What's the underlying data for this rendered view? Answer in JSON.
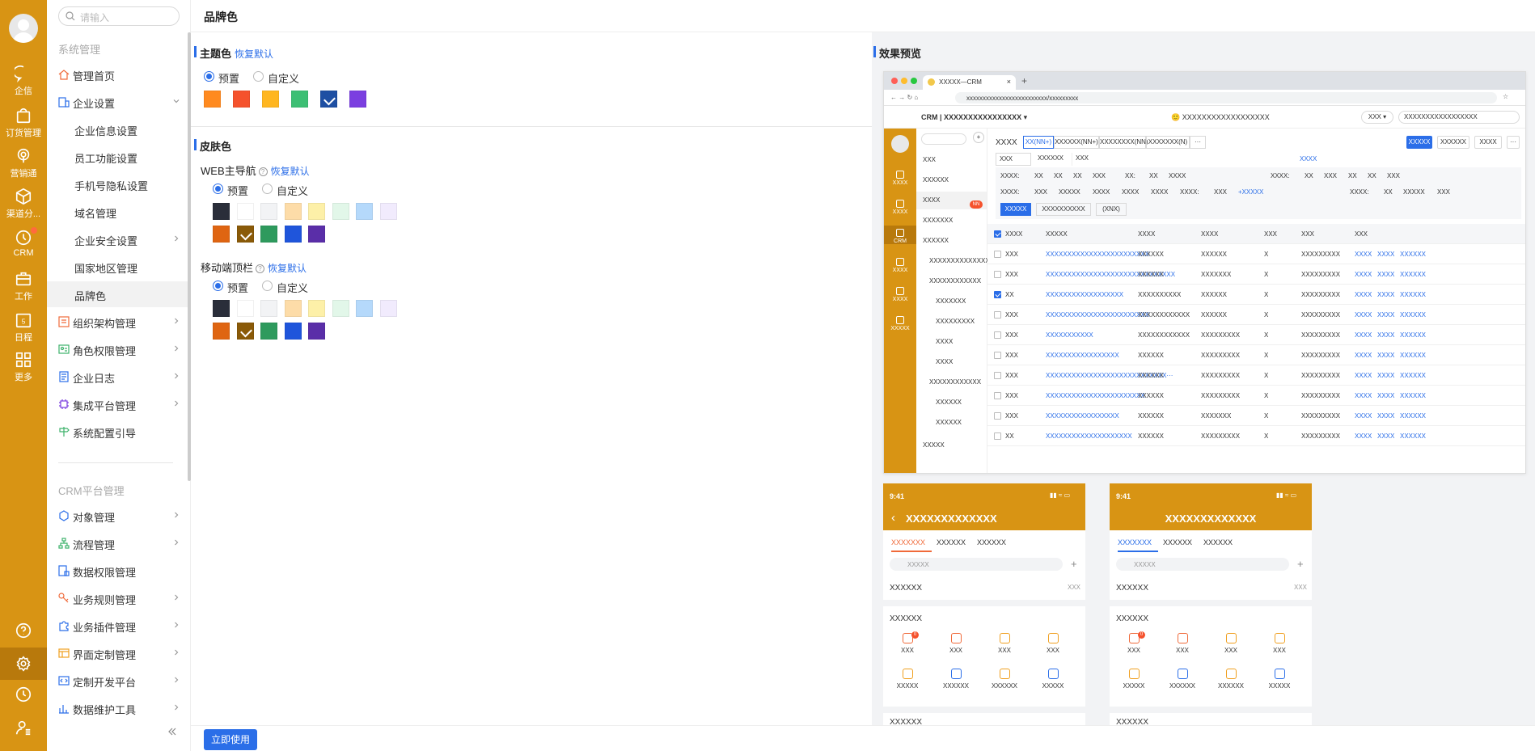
{
  "colors": {
    "brand": "#D89414",
    "accent": "#2b6ee8"
  },
  "rail": {
    "items": [
      {
        "label": "企信",
        "icon": "chat-icon"
      },
      {
        "label": "订货管理",
        "icon": "bag-icon"
      },
      {
        "label": "营销通",
        "icon": "broadcast-icon"
      },
      {
        "label": "渠道分...",
        "icon": "cube-icon"
      },
      {
        "label": "CRM",
        "icon": "clock-icon"
      },
      {
        "label": "工作",
        "icon": "briefcase-icon"
      },
      {
        "label": "日程",
        "icon": "calendar-icon",
        "day": "5"
      },
      {
        "label": "更多",
        "icon": "grid-icon"
      }
    ]
  },
  "menu": {
    "search_placeholder": "请输入",
    "group1": "系统管理",
    "group2": "CRM平台管理",
    "items1": [
      "管理首页",
      "企业设置",
      "企业信息设置",
      "员工功能设置",
      "手机号隐私设置",
      "域名管理",
      "企业安全设置",
      "国家地区管理",
      "品牌色",
      "组织架构管理",
      "角色权限管理",
      "企业日志",
      "集成平台管理",
      "系统配置引导"
    ],
    "items2": [
      "对象管理",
      "流程管理",
      "数据权限管理",
      "业务规则管理",
      "业务插件管理",
      "界面定制管理",
      "定制开发平台",
      "数据维护工具"
    ]
  },
  "header": {
    "title": "品牌色"
  },
  "theme": {
    "title": "主题色",
    "reset": "恢复默认",
    "preset": "预置",
    "custom": "自定义",
    "swatches": [
      "#FF8A1F",
      "#F5522D",
      "#FFB620",
      "#3DBF74",
      "#1E4FA3",
      "#7B3FE0"
    ],
    "selected": 4
  },
  "skin": {
    "title": "皮肤色",
    "web": {
      "title": "WEB主导航",
      "reset": "恢复默认",
      "preset": "预置",
      "custom": "自定义",
      "row1": [
        "#2A2E3A",
        "#FFFFFF",
        "#F2F3F5",
        "#FDDCA8",
        "#FDF0A8",
        "#E2F7E9",
        "#B5D9FB",
        "#F1EBFD"
      ],
      "row2": [
        "#DF6512",
        "#8A5A08",
        "#2E9A5D",
        "#1F55DB",
        "#5A2EA8"
      ],
      "selected": 1
    },
    "mobile": {
      "title": "移动端顶栏",
      "reset": "恢复默认",
      "preset": "预置",
      "custom": "自定义",
      "row1": [
        "#2A2E3A",
        "#FFFFFF",
        "#F2F3F5",
        "#FDDCA8",
        "#FDF0A8",
        "#E2F7E9",
        "#B5D9FB",
        "#F1EBFD"
      ],
      "row2": [
        "#DF6512",
        "#8A5A08",
        "#2E9A5D",
        "#1F55DB",
        "#5A2EA8"
      ],
      "selected": 1
    }
  },
  "footer": {
    "apply": "立即使用"
  },
  "preview": {
    "title": "效果预览",
    "browser": {
      "tab": "XXXXX—CRM",
      "url": "xxxxxxxxxxxxxxxxxxxxxxxxx/xxxxxxxxx",
      "crm_label": "CRM",
      "crm_title": "XXXXXXXXXXXXXXXX",
      "center_title": "XXXXXXXXXXXXXXXXXX",
      "user": "XXX",
      "search": "XXXXXXXXXXXXXXXXX",
      "rail_labels": [
        "XXXX",
        "XXXX",
        "CRM",
        "XXXX",
        "XXXX",
        "XXXXX"
      ],
      "side_items": [
        "XXX",
        "XXXXXX",
        "XXXX",
        "XXXXXXX",
        "XXXXXX",
        "XXXXXXXXXXXXXXX",
        "XXXXXXXXXXXX",
        "XXXXXXX",
        "XXXXXXXXX",
        "XXXX",
        "XXXX",
        "XXXXXXXXXXXX",
        "XXXXXX",
        "XXXXXX",
        "XXXXX"
      ],
      "side_badge": "NN",
      "page_title": "XXXX",
      "tabs": [
        "XX(NN+)",
        "XXXXXX(NN+)",
        "XXXXXXXX(NN)",
        "XXXXXXX(N)",
        "···"
      ],
      "actions": [
        "XXXXX",
        "XXXXXX",
        "XXXX",
        "···"
      ],
      "filter_chip": "XXX",
      "filter_drop": "XXXXXX",
      "filter_input": "XXX",
      "view": "XXXX",
      "cond_row1": [
        "XXXX:",
        "XX",
        "XX",
        "XX",
        "XXX",
        "XX:",
        "XX",
        "XXXX",
        "XXXX:",
        "XX",
        "XXX",
        "XX",
        "XX",
        "XXX"
      ],
      "cond_row2": [
        "XXXX:",
        "XXX",
        "XXXXX",
        "XXXX",
        "XXXX",
        "XXXX",
        "XXXX:",
        "XXX",
        "+XXXXX",
        "XXXX:",
        "XX",
        "XXXXX",
        "XXX"
      ],
      "cond_btns": [
        "XXXXX",
        "XXXXXXXXXX",
        "(XNX)"
      ],
      "columns": [
        "XXXX",
        "XXXXX",
        "XXXX",
        "XXXX",
        "XXX",
        "XXX",
        "XXX"
      ],
      "rows": [
        [
          "XXX",
          "XXXXXXXXXXXXXXXXXXXXXXXX",
          "XXXXXX",
          "XXXXXX",
          "X",
          "XXXXXXXXX",
          false
        ],
        [
          "XXX",
          "XXXXXXXXXXXXXXXXXXXXXXXXXXXXXX",
          "XXXXXX",
          "XXXXXXX",
          "X",
          "XXXXXXXXX",
          false
        ],
        [
          "XX",
          "XXXXXXXXXXXXXXXXXX",
          "XXXXXXXXXX",
          "XXXXXX",
          "X",
          "XXXXXXXXX",
          true
        ],
        [
          "XXX",
          "XXXXXXXXXXXXXXXXXXXXXXXX",
          "XXXXXXXXXXXX",
          "XXXXXX",
          "X",
          "XXXXXXXXX",
          false
        ],
        [
          "XXX",
          "XXXXXXXXXXX",
          "XXXXXXXXXXXX",
          "XXXXXXXXX",
          "X",
          "XXXXXXXXX",
          false
        ],
        [
          "XXX",
          "XXXXXXXXXXXXXXXXX",
          "XXXXXX",
          "XXXXXXXXX",
          "X",
          "XXXXXXXXX",
          false
        ],
        [
          "XXX",
          "XXXXXXXXXXXXXXXXXXXXXXXXXXXX···",
          "XXXXXX",
          "XXXXXXXXX",
          "X",
          "XXXXXXXXX",
          false
        ],
        [
          "XXX",
          "XXXXXXXXXXXXXXXXXXXXXXX",
          "XXXXXX",
          "XXXXXXXXX",
          "X",
          "XXXXXXXXX",
          false
        ],
        [
          "XXX",
          "XXXXXXXXXXXXXXXXX",
          "XXXXXX",
          "XXXXXXX",
          "X",
          "XXXXXXXXX",
          false
        ],
        [
          "XX",
          "XXXXXXXXXXXXXXXXXXXX",
          "XXXXXX",
          "XXXXXXXXX",
          "X",
          "XXXXXXXXX",
          false
        ]
      ],
      "row_actions": [
        "XXXX",
        "XXXX",
        "XXXXXX"
      ]
    },
    "phone1": {
      "time": "9:41",
      "title": "XXXXXXXXXXXXX",
      "tabs": [
        "XXXXXXX",
        "XXXXXX",
        "XXXXXX"
      ],
      "search": "XXXXX",
      "filter": "XXXXXX",
      "filter_right": "XXX",
      "section": "XXXXXX",
      "icons": [
        {
          "label": "XXX",
          "icon": "clock-icon",
          "badge": "0"
        },
        {
          "label": "XXX",
          "icon": "briefcase-icon"
        },
        {
          "label": "XXX",
          "icon": "chat-icon"
        },
        {
          "label": "XXX",
          "icon": "shield-check-icon"
        },
        {
          "label": "XXXXX",
          "icon": "coin-icon"
        },
        {
          "label": "XXXXXX",
          "icon": "building-icon"
        },
        {
          "label": "XXXXXX",
          "icon": "document-icon"
        },
        {
          "label": "XXXXX",
          "icon": "book-icon"
        }
      ],
      "bottom": "XXXXXX"
    },
    "phone2": {
      "time": "9:41",
      "title": "XXXXXXXXXXXXX",
      "tabs": [
        "XXXXXXX",
        "XXXXXX",
        "XXXXXX"
      ],
      "search": "XXXXX",
      "filter": "XXXXXX",
      "filter_right": "XXX",
      "section": "XXXXXX",
      "icons": [
        {
          "label": "XXX",
          "icon": "clock-icon",
          "badge": "0"
        },
        {
          "label": "XXX",
          "icon": "briefcase-icon"
        },
        {
          "label": "XXX",
          "icon": "chat-icon"
        },
        {
          "label": "XXX",
          "icon": "shield-check-icon"
        },
        {
          "label": "XXXXX",
          "icon": "coin-icon"
        },
        {
          "label": "XXXXXX",
          "icon": "building-icon"
        },
        {
          "label": "XXXXXX",
          "icon": "document-icon"
        },
        {
          "label": "XXXXX",
          "icon": "book-icon"
        }
      ],
      "bottom": "XXXXXX"
    }
  }
}
